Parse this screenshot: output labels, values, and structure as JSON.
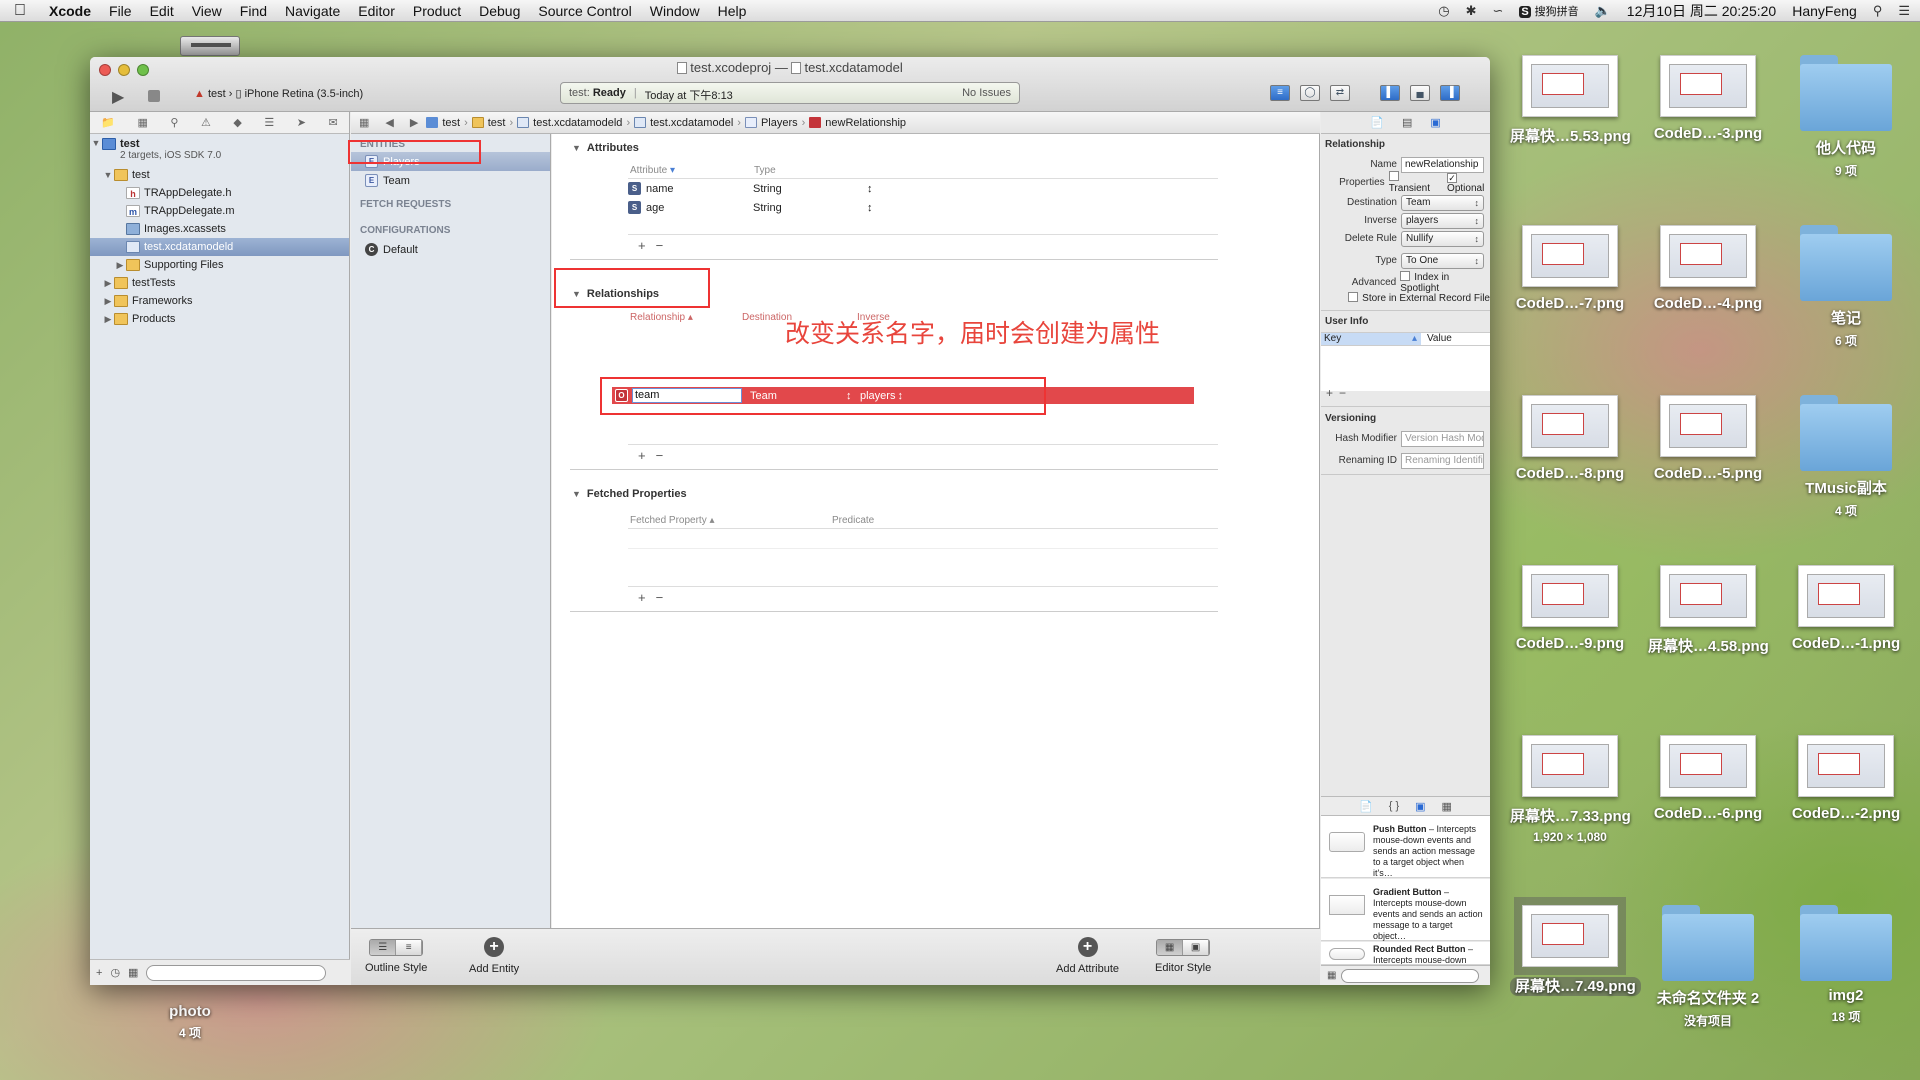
{
  "menubar": {
    "items": [
      "Xcode",
      "File",
      "Edit",
      "View",
      "Find",
      "Navigate",
      "Editor",
      "Product",
      "Debug",
      "Source Control",
      "Window",
      "Help"
    ],
    "ime": "S",
    "ime_label": "搜狗拼音",
    "datetime": "12月10日 周二 20:25:20",
    "user": "HanyFeng"
  },
  "window": {
    "title_project": "test.xcodeproj",
    "title_sep": "—",
    "title_model": "test.xcdatamodel",
    "scheme": "test",
    "device": "iPhone Retina (3.5-inch)",
    "activity_name": "test:",
    "activity_status": "Ready",
    "activity_time": "Today at 下午8:13",
    "activity_issues": "No Issues"
  },
  "navigator": {
    "tree": [
      {
        "label": "test",
        "sub": "2 targets, iOS SDK 7.0",
        "kind": "project"
      },
      {
        "label": "test",
        "kind": "folder"
      },
      {
        "label": "TRAppDelegate.h",
        "kind": "h"
      },
      {
        "label": "TRAppDelegate.m",
        "kind": "m"
      },
      {
        "label": "Images.xcassets",
        "kind": "asset"
      },
      {
        "label": "test.xcdatamodeld",
        "kind": "datamodel",
        "selected": true
      },
      {
        "label": "Supporting Files",
        "kind": "folder"
      },
      {
        "label": "testTests",
        "kind": "folder"
      },
      {
        "label": "Frameworks",
        "kind": "folder"
      },
      {
        "label": "Products",
        "kind": "folder"
      }
    ]
  },
  "jumpbar": [
    "test",
    "test",
    "test.xcdatamodeld",
    "test.xcdatamodel",
    "Players",
    "newRelationship"
  ],
  "entities": {
    "entities_header": "ENTITIES",
    "items": [
      "Players",
      "Team"
    ],
    "fetch_header": "FETCH REQUESTS",
    "config_header": "CONFIGURATIONS",
    "configs": [
      "Default"
    ]
  },
  "editor": {
    "attributes_title": "Attributes",
    "attr_col1": "Attribute",
    "attr_col2": "Type",
    "attributes": [
      {
        "name": "name",
        "type": "String"
      },
      {
        "name": "age",
        "type": "String"
      }
    ],
    "relationships_title": "Relationships",
    "rel_col1": "Relationship",
    "rel_col2": "Destination",
    "rel_col3": "Inverse",
    "relationship": {
      "name": "team",
      "destination": "Team",
      "inverse": "players"
    },
    "fetched_title": "Fetched Properties",
    "fetched_col1": "Fetched Property",
    "fetched_col2": "Predicate",
    "annotation": "改变关系名字，届时会创建为属性"
  },
  "bottombar": {
    "outline_style": "Outline Style",
    "add_entity": "Add Entity",
    "add_attribute": "Add Attribute",
    "editor_style": "Editor Style"
  },
  "inspector": {
    "section": "Relationship",
    "name_label": "Name",
    "name_value": "newRelationship",
    "properties_label": "Properties",
    "transient": "Transient",
    "optional": "Optional",
    "destination_label": "Destination",
    "destination": "Team",
    "inverse_label": "Inverse",
    "inverse": "players",
    "delete_rule_label": "Delete Rule",
    "delete_rule": "Nullify",
    "type_label": "Type",
    "type": "To One",
    "advanced_label": "Advanced",
    "index_spotlight": "Index in Spotlight",
    "store_external": "Store in External Record File",
    "user_info": "User Info",
    "key_col": "Key",
    "value_col": "Value",
    "versioning": "Versioning",
    "hash_label": "Hash Modifier",
    "hash_placeholder": "Version Hash Modifier",
    "renaming_label": "Renaming ID",
    "renaming_placeholder": "Renaming Identifier",
    "library": [
      {
        "title": "Push Button",
        "desc": " – Intercepts mouse-down events and sends an action message to a target object when it's…"
      },
      {
        "title": "Gradient Button",
        "desc": " – Intercepts mouse-down events and sends an action message to a target object…"
      },
      {
        "title": "Rounded Rect Button",
        "desc": " – Intercepts mouse-down events and sends an action message to a target object…"
      }
    ]
  },
  "desktop": [
    {
      "label": "屏幕快…5.53.png",
      "kind": "thumb"
    },
    {
      "label": "CodeD…-3.png",
      "kind": "thumb"
    },
    {
      "label": "他人代码",
      "sub": "9 项",
      "kind": "folder"
    },
    {
      "label": "CodeD…-7.png",
      "kind": "thumb"
    },
    {
      "label": "CodeD…-4.png",
      "kind": "thumb"
    },
    {
      "label": "笔记",
      "sub": "6 项",
      "kind": "folder"
    },
    {
      "label": "CodeD…-8.png",
      "kind": "thumb"
    },
    {
      "label": "CodeD…-5.png",
      "kind": "thumb"
    },
    {
      "label": "TMusic副本",
      "sub": "4 项",
      "kind": "folder"
    },
    {
      "label": "CodeD…-9.png",
      "kind": "thumb"
    },
    {
      "label": "屏幕快…4.58.png",
      "kind": "thumb"
    },
    {
      "label": "CodeD…-1.png",
      "kind": "thumb"
    },
    {
      "label": "屏幕快…7.33.png",
      "sub": "1,920 × 1,080",
      "kind": "thumb"
    },
    {
      "label": "CodeD…-6.png",
      "kind": "thumb"
    },
    {
      "label": "CodeD…-2.png",
      "kind": "thumb"
    },
    {
      "label": "屏幕快…7.49.png",
      "kind": "thumb",
      "selected": true
    },
    {
      "label": "未命名文件夹 2",
      "sub": "没有项目",
      "kind": "folder"
    },
    {
      "label": "img2",
      "sub": "18 项",
      "kind": "folder"
    }
  ],
  "desktop_left": {
    "label": "photo",
    "sub": "4 项"
  },
  "colors": {
    "selection_red": "#e2484b",
    "annotation_red": "#e8453c",
    "highlight_box": "#ee3333"
  }
}
